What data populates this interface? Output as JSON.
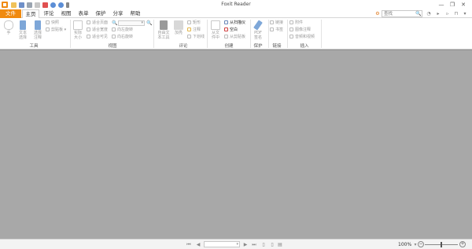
{
  "window": {
    "title": "Foxit Reader",
    "minimize_glyph": "—",
    "restore_glyph": "❐",
    "close_glyph": "✕"
  },
  "colors": {
    "accent": "#f08a10",
    "doc_background": "#a8a8a8",
    "link_blue": "#3a6ab0"
  },
  "menu_tabs": [
    "文件",
    "主页",
    "评论",
    "视图",
    "表单",
    "保护",
    "分享",
    "帮助"
  ],
  "search": {
    "placeholder": "查找",
    "button_glyph": "🔍"
  },
  "ribbon": {
    "tools": {
      "group": "工具",
      "hand": "手",
      "select_text_1": "文本",
      "select_text_2": "选择",
      "select_note_1": "选择",
      "select_note_2": "注释",
      "snapshot": "快照",
      "clipboard": "剪贴板"
    },
    "view": {
      "group": "视图",
      "actual_1": "实际",
      "actual_2": "大小",
      "fit_page": "适合页面",
      "fit_width": "适合宽度",
      "fit_visible": "适合可见",
      "rotate_left": "向左旋转",
      "rotate_right": "向右旋转"
    },
    "comment": {
      "group": "评论",
      "typewriter_1": "自由文",
      "typewriter_2": "本工具",
      "highlight": "加亮",
      "rect": "矩形",
      "note": "注释",
      "underline": "下划线"
    },
    "create": {
      "group": "创建",
      "from_file_1": "从文",
      "from_file_2": "件中",
      "from_scanner": "从扫描仪",
      "blank": "空白",
      "from_clipboard": "从剪贴板"
    },
    "protect": {
      "group": "保护",
      "pdf_sign_1": "PDF",
      "pdf_sign_2": "签名"
    },
    "links": {
      "group": "链接",
      "link": "链接",
      "bookmark": "书签"
    },
    "insert": {
      "group": "插入",
      "attachment": "附件",
      "image": "图像注释",
      "audio_video": "音频和视频"
    }
  },
  "status": {
    "zoom": "100%",
    "minus": "−",
    "plus": "+"
  }
}
